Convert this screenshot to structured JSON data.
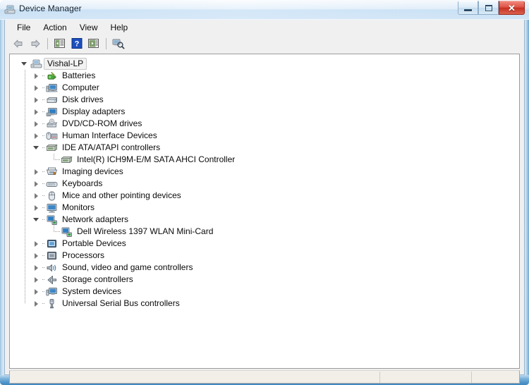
{
  "window": {
    "title": "Device Manager",
    "icon": "device-manager-icon",
    "controls": {
      "minimize": "Minimize",
      "maximize": "Maximize",
      "close": "Close",
      "close_glyph": "✕"
    }
  },
  "menu": {
    "items": [
      {
        "label": "File",
        "name": "menu-file"
      },
      {
        "label": "Action",
        "name": "menu-action"
      },
      {
        "label": "View",
        "name": "menu-view"
      },
      {
        "label": "Help",
        "name": "menu-help"
      }
    ]
  },
  "toolbar": {
    "buttons": [
      {
        "name": "back-button",
        "icon": "back-arrow-icon"
      },
      {
        "name": "forward-button",
        "icon": "forward-arrow-icon"
      },
      {
        "name": "show-hide-console-tree-button",
        "icon": "console-tree-icon"
      },
      {
        "name": "help-button",
        "icon": "question-mark-icon"
      },
      {
        "name": "properties-button",
        "icon": "properties-panel-icon"
      },
      {
        "name": "scan-for-hardware-changes-button",
        "icon": "scan-hardware-icon"
      }
    ]
  },
  "tree": {
    "root": {
      "label": "Vishal-LP",
      "icon": "computer-node-icon",
      "expanded": true,
      "selected": true
    },
    "nodes": [
      {
        "label": "Batteries",
        "icon": "battery-icon",
        "expanded": false,
        "children": []
      },
      {
        "label": "Computer",
        "icon": "computer-icon",
        "expanded": false,
        "children": []
      },
      {
        "label": "Disk drives",
        "icon": "disk-drive-icon",
        "expanded": false,
        "children": []
      },
      {
        "label": "Display adapters",
        "icon": "display-adapter-icon",
        "expanded": false,
        "children": []
      },
      {
        "label": "DVD/CD-ROM drives",
        "icon": "dvd-drive-icon",
        "expanded": false,
        "children": []
      },
      {
        "label": "Human Interface Devices",
        "icon": "hid-icon",
        "expanded": false,
        "children": []
      },
      {
        "label": "IDE ATA/ATAPI controllers",
        "icon": "ide-controller-icon",
        "expanded": true,
        "children": [
          {
            "label": "Intel(R) ICH9M-E/M SATA AHCI Controller",
            "icon": "ide-controller-icon"
          }
        ]
      },
      {
        "label": "Imaging devices",
        "icon": "imaging-device-icon",
        "expanded": false,
        "children": []
      },
      {
        "label": "Keyboards",
        "icon": "keyboard-icon",
        "expanded": false,
        "children": []
      },
      {
        "label": "Mice and other pointing devices",
        "icon": "mouse-icon",
        "expanded": false,
        "children": []
      },
      {
        "label": "Monitors",
        "icon": "monitor-icon",
        "expanded": false,
        "children": []
      },
      {
        "label": "Network adapters",
        "icon": "network-adapter-icon",
        "expanded": true,
        "children": [
          {
            "label": "Dell Wireless 1397 WLAN Mini-Card",
            "icon": "network-adapter-icon"
          }
        ]
      },
      {
        "label": "Portable Devices",
        "icon": "portable-device-icon",
        "expanded": false,
        "children": []
      },
      {
        "label": "Processors",
        "icon": "processor-icon",
        "expanded": false,
        "children": []
      },
      {
        "label": "Sound, video and game controllers",
        "icon": "sound-controller-icon",
        "expanded": false,
        "children": []
      },
      {
        "label": "Storage controllers",
        "icon": "storage-controller-icon",
        "expanded": false,
        "children": []
      },
      {
        "label": "System devices",
        "icon": "system-device-icon",
        "expanded": false,
        "children": []
      },
      {
        "label": "Universal Serial Bus controllers",
        "icon": "usb-controller-icon",
        "expanded": false,
        "children": []
      }
    ]
  },
  "status_bar": {
    "panels": [
      "",
      "",
      ""
    ]
  },
  "colors": {
    "title_gradient_start": "#e8f1fa",
    "title_gradient_end": "#b4cfe8",
    "close_button": "#c72f21",
    "frame_blue": "#3f86bd",
    "tree_background": "#ffffff",
    "chrome_background": "#f0f0f0",
    "status_background": "#f2efe9",
    "text": "#0a0a0a"
  }
}
